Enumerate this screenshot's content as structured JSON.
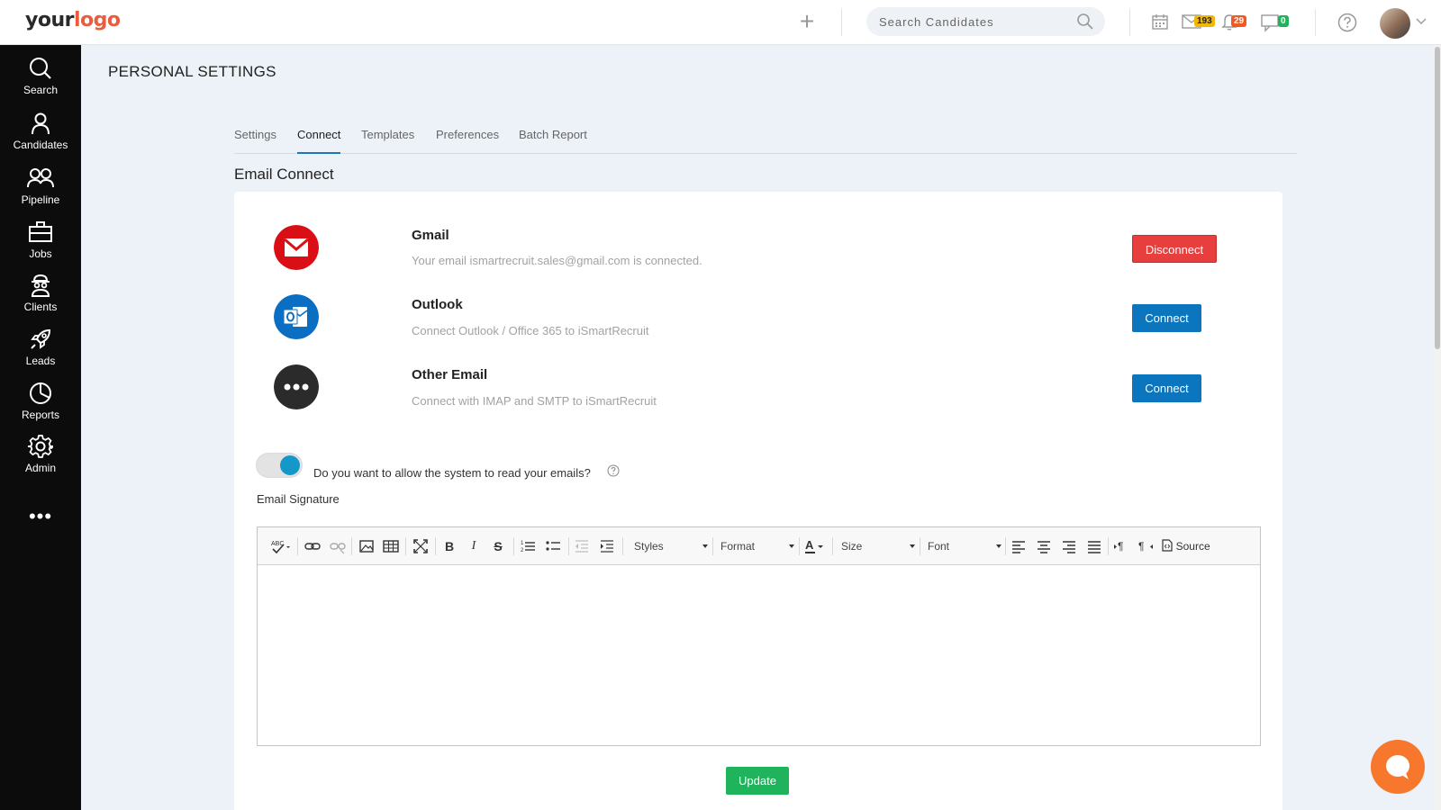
{
  "header": {
    "logo_part1": "your",
    "logo_part2": "logo",
    "search_placeholder": "Search Candidates",
    "mail_count": "193",
    "notification_count": "29",
    "chat_count": "0"
  },
  "sidebar": {
    "items": [
      {
        "label": "Search",
        "icon": "search-icon"
      },
      {
        "label": "Candidates",
        "icon": "user-icon"
      },
      {
        "label": "Pipeline",
        "icon": "users-icon"
      },
      {
        "label": "Jobs",
        "icon": "briefcase-icon"
      },
      {
        "label": "Clients",
        "icon": "client-icon"
      },
      {
        "label": "Leads",
        "icon": "rocket-icon"
      },
      {
        "label": "Reports",
        "icon": "pie-chart-icon"
      },
      {
        "label": "Admin",
        "icon": "gear-icon"
      }
    ],
    "more": "•••"
  },
  "page": {
    "title": "PERSONAL SETTINGS",
    "tabs": [
      {
        "label": "Settings",
        "active": false
      },
      {
        "label": "Connect",
        "active": true
      },
      {
        "label": "Templates",
        "active": false
      },
      {
        "label": "Preferences",
        "active": false
      },
      {
        "label": "Batch Report",
        "active": false
      }
    ],
    "section_title": "Email Connect"
  },
  "providers": [
    {
      "name": "Gmail",
      "description": "Your email ismartrecruit.sales@gmail.com is connected.",
      "button": "Disconnect",
      "status": "connected"
    },
    {
      "name": "Outlook",
      "description": "Connect Outlook / Office 365 to iSmartRecruit",
      "button": "Connect",
      "status": "disconnected"
    },
    {
      "name": "Other Email",
      "description": "Connect with IMAP and SMTP to iSmartRecruit",
      "button": "Connect",
      "status": "disconnected"
    }
  ],
  "settings": {
    "read_emails_label": "Do you want to allow the system to read your emails?",
    "read_emails_enabled": true,
    "signature_label": "Email Signature"
  },
  "editor": {
    "styles_label": "Styles",
    "format_label": "Format",
    "size_label": "Size",
    "font_label": "Font",
    "source_label": "Source",
    "bold": "B",
    "italic": "I",
    "strike": "S",
    "content": ""
  },
  "actions": {
    "update_label": "Update"
  },
  "colors": {
    "sidebar_bg": "#0c0c0c",
    "accent_blue": "#0b76bd",
    "danger_red": "#e73e3e",
    "success_green": "#1fb35c",
    "chat_orange": "#f7772c"
  }
}
